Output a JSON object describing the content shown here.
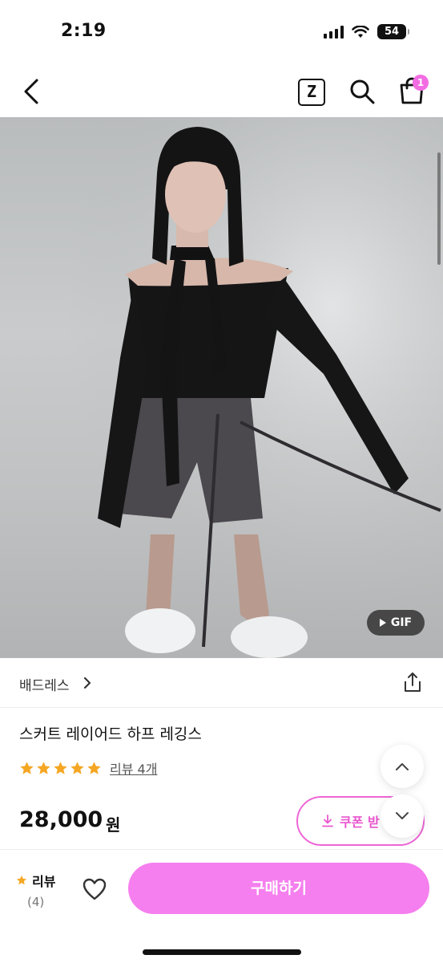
{
  "status_bar": {
    "time": "2:19",
    "battery": "54"
  },
  "nav": {
    "z_label": "Z",
    "cart_count": "1",
    "icons": [
      "back-icon",
      "z-icon",
      "search-icon",
      "shopping-bag-icon"
    ]
  },
  "product": {
    "gif_label": "GIF",
    "shop_name": "배드레스",
    "title": "스커트 레이어드 하프 레깅스",
    "rating_stars": 5,
    "review_link": "리뷰 4개",
    "price": "28,000",
    "price_unit": "원",
    "coupon_label": "쿠폰 받"
  },
  "bottom_bar": {
    "review_label": "리뷰",
    "review_count": "(4)",
    "buy_label": "구매하기"
  },
  "colors": {
    "accent": "#f57fee",
    "coupon": "#ee66d6",
    "star": "#f5a623"
  }
}
